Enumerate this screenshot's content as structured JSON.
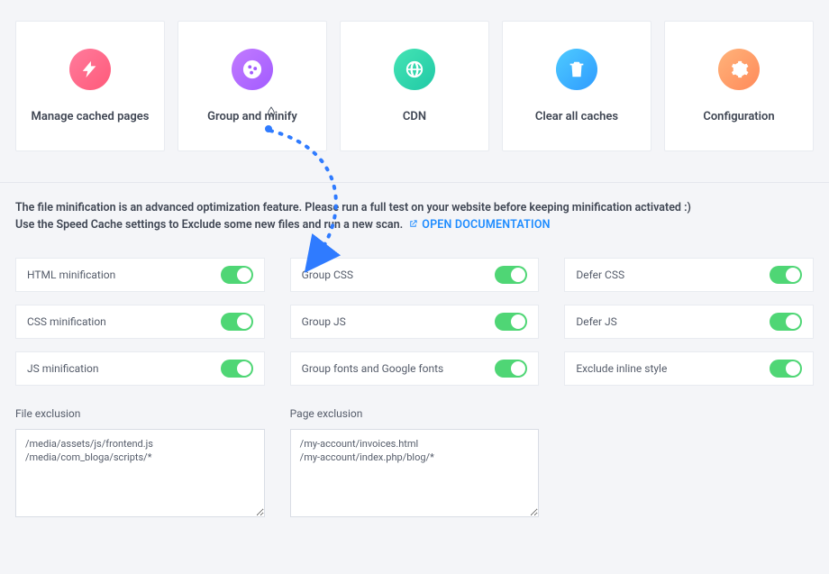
{
  "nav": {
    "cards": [
      {
        "label": "Manage cached pages"
      },
      {
        "label": "Group and minify"
      },
      {
        "label": "CDN"
      },
      {
        "label": "Clear all caches"
      },
      {
        "label": "Configuration"
      }
    ]
  },
  "intro": {
    "line1": "The file minification is an advanced optimization feature. Please run a full test on your website before keeping minification activated :)",
    "line2_prefix": "Use the Speed Cache settings to Exclude some new files and run a new scan.",
    "doc_link_label": "OPEN DOCUMENTATION"
  },
  "settings": {
    "col1": [
      {
        "label": "HTML minification",
        "on": true
      },
      {
        "label": "CSS minification",
        "on": true
      },
      {
        "label": "JS minification",
        "on": true
      }
    ],
    "col2": [
      {
        "label": "Group CSS",
        "on": true
      },
      {
        "label": "Group JS",
        "on": true
      },
      {
        "label": "Group fonts and Google fonts",
        "on": true
      }
    ],
    "col3": [
      {
        "label": "Defer CSS",
        "on": true
      },
      {
        "label": "Defer JS",
        "on": true
      },
      {
        "label": "Exclude inline style",
        "on": true
      }
    ]
  },
  "exclusions": {
    "file": {
      "label": "File exclusion",
      "value": "/media/assets/js/frontend.js\n/media/com_bloga/scripts/*"
    },
    "page": {
      "label": "Page exclusion",
      "value": "/my-account/invoices.html\n/my-account/index.php/blog/*"
    }
  },
  "colors": {
    "toggle_on": "#4fd675",
    "link": "#1e8cff"
  }
}
